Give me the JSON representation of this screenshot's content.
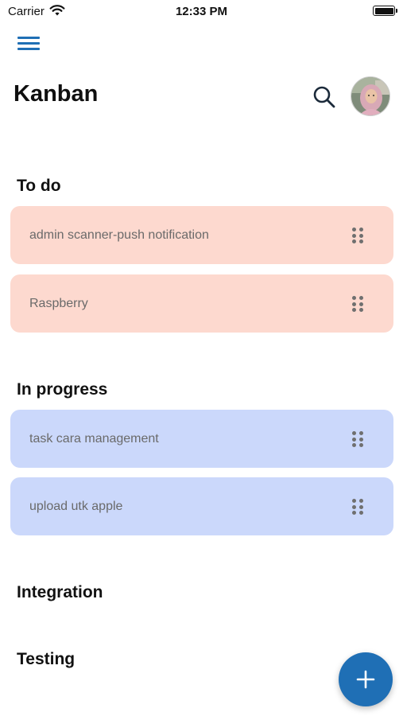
{
  "status_bar": {
    "carrier": "Carrier",
    "time": "12:33 PM"
  },
  "header": {
    "title": "Kanban"
  },
  "icons": {
    "menu": "hamburger-menu-icon",
    "search": "search-icon",
    "avatar": "user-avatar",
    "drag": "drag-handle-icon",
    "fab": "plus-icon"
  },
  "colors": {
    "accent": "#1f6fb5",
    "todo_card": "#fdd9cf",
    "progress_card": "#cbd8fb"
  },
  "sections": {
    "todo": {
      "title": "To do",
      "cards": [
        {
          "label": "admin scanner-push notification"
        },
        {
          "label": "Raspberry"
        }
      ]
    },
    "in_progress": {
      "title": "In progress",
      "cards": [
        {
          "label": "task cara management"
        },
        {
          "label": "upload utk apple"
        }
      ]
    },
    "integration": {
      "title": "Integration"
    },
    "testing": {
      "title": "Testing"
    }
  }
}
